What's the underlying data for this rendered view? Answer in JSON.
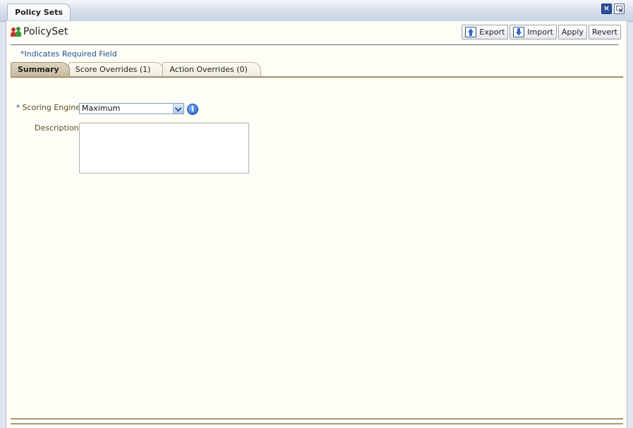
{
  "window": {
    "tab_label": "Policy Sets"
  },
  "header": {
    "title": "PolicySet",
    "required_note": "*Indicates Required Field"
  },
  "toolbar": {
    "export_label": "Export",
    "import_label": "Import",
    "apply_label": "Apply",
    "revert_label": "Revert"
  },
  "tabs": [
    {
      "label": "Summary",
      "active": true
    },
    {
      "label": "Score Overrides (1)",
      "active": false
    },
    {
      "label": "Action Overrides (0)",
      "active": false
    }
  ],
  "form": {
    "scoring_engine": {
      "required_mark": "*",
      "label": "Scoring Engine",
      "value": "Maximum"
    },
    "description": {
      "label": "Description",
      "value": ""
    }
  },
  "icons": {
    "info": "info-icon",
    "policy_set": "users-icon",
    "export": "export-icon",
    "import": "import-icon",
    "close": "close-icon",
    "detach": "detach-icon"
  }
}
